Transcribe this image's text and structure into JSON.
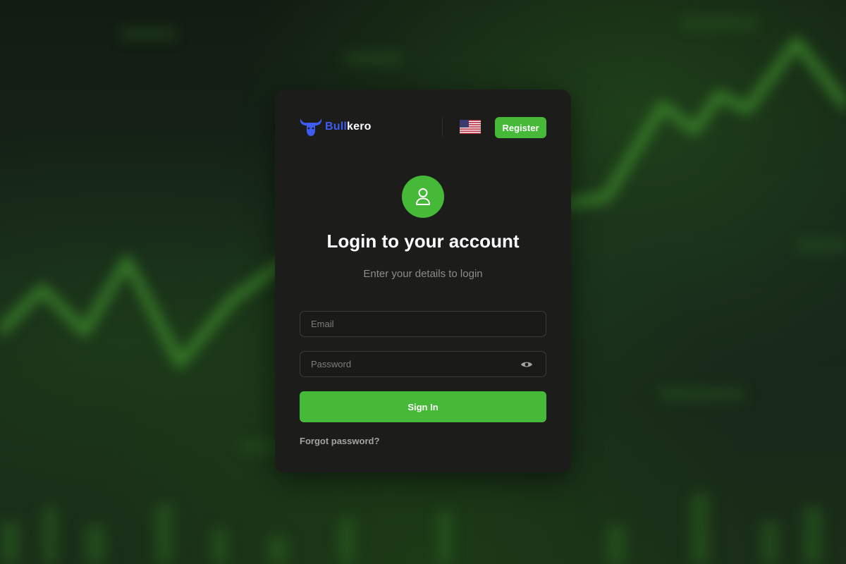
{
  "brand": {
    "name_part1": "Bull",
    "name_part2": "kero",
    "icon": "bull-head-icon",
    "color": "#3e5cf2"
  },
  "header": {
    "language_flag": "us-flag-icon",
    "register_label": "Register"
  },
  "login": {
    "avatar_icon": "user-icon",
    "title": "Login to your account",
    "subtitle": "Enter your details to login",
    "email_placeholder": "Email",
    "password_placeholder": "Password",
    "password_toggle_icon": "eye-icon",
    "signin_label": "Sign In",
    "forgot_label": "Forgot password?"
  },
  "colors": {
    "accent": "#46b938",
    "card": "#1c1c1a",
    "brand_blue": "#3e5cf2"
  }
}
